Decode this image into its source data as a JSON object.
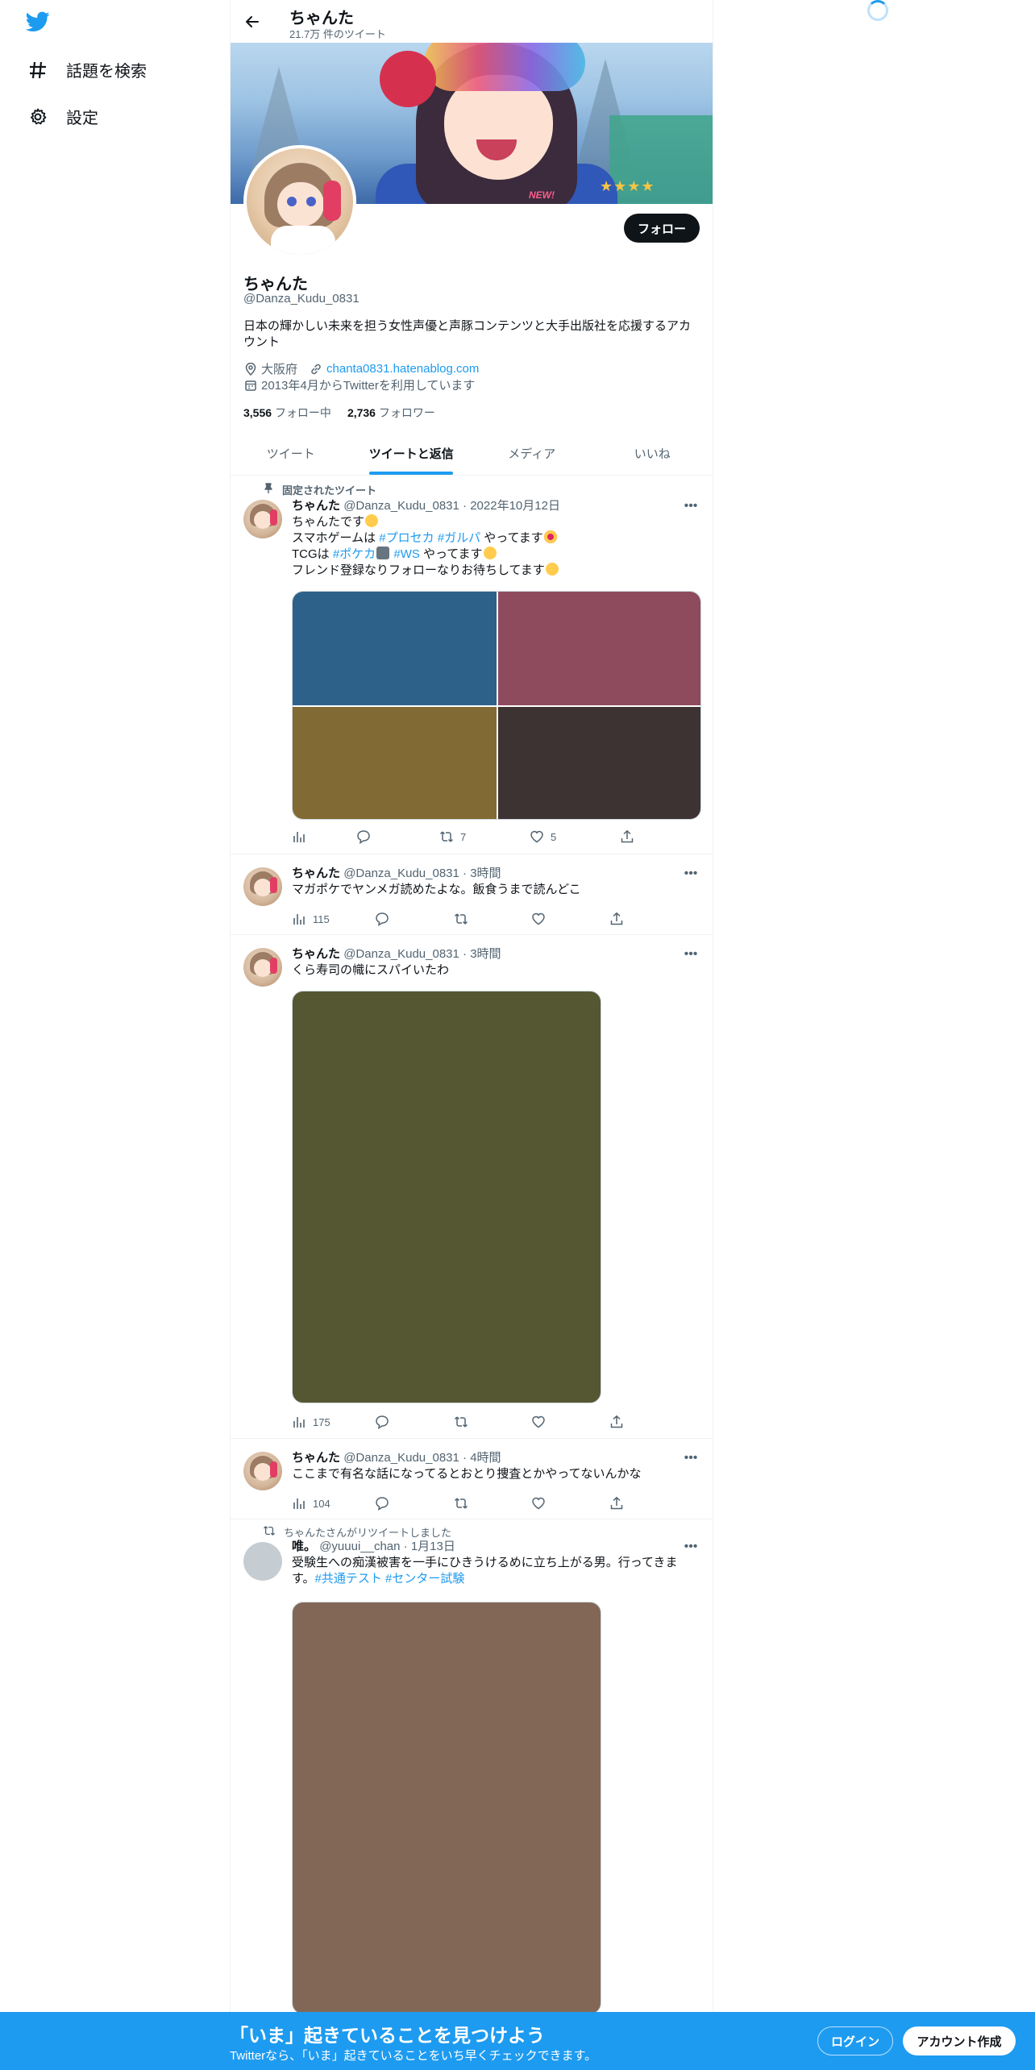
{
  "colors": {
    "accent": "#1d9bf0",
    "text": "#0f1419",
    "muted": "#536471",
    "border": "#eff3f4"
  },
  "nav": {
    "logo_icon": "twitter-bird-icon",
    "items": [
      {
        "label": "話題を検索",
        "icon": "hashtag-icon"
      },
      {
        "label": "設定",
        "icon": "gear-icon"
      }
    ]
  },
  "header": {
    "title": "ちゃんた",
    "subtitle": "21.7万 件のツイート"
  },
  "profile": {
    "name": "ちゃんた",
    "handle": "@Danza_Kudu_0831",
    "bio": "日本の輝かしい未来を担う女性声優と声豚コンテンツと大手出版社を応援するアカウント",
    "location": "大阪府",
    "url": "chanta0831.hatenablog.com",
    "joined": "2013年4月からTwitterを利用しています",
    "following_count": "3,556",
    "following_label": "フォロー中",
    "followers_count": "2,736",
    "followers_label": "フォロワー",
    "follow_button": "フォロー",
    "banner_badge": "NEW!"
  },
  "tabs": [
    {
      "label": "ツイート",
      "active": false
    },
    {
      "label": "ツイートと返信",
      "active": true
    },
    {
      "label": "メディア",
      "active": false
    },
    {
      "label": "いいね",
      "active": false
    }
  ],
  "tweets": [
    {
      "social_context": "固定されたツイート",
      "name": "ちゃんた",
      "handle": "@Danza_Kudu_0831",
      "time": "2022年10月12日",
      "lines": [
        [
          "ちゃんたです"
        ],
        [
          "スマホゲームは ",
          "#プロセカ",
          " ",
          "#ガルパ",
          " やってます"
        ],
        [
          "TCGは ",
          "#ポケカ",
          " ",
          "#WS",
          " やってます"
        ],
        [
          "フレンド登録なりフォローなりお待ちしてます"
        ]
      ],
      "images": [
        "#2e6189",
        "#8f4b5e",
        "#826a34",
        "#3d3333"
      ],
      "views": "",
      "replies": "",
      "retweets": "7",
      "likes": "5"
    },
    {
      "name": "ちゃんた",
      "handle": "@Danza_Kudu_0831",
      "time": "3時間",
      "text": "マガポケでヤンメガ読めたよな。飯食うまで読んどこ",
      "views": "115"
    },
    {
      "name": "ちゃんた",
      "handle": "@Danza_Kudu_0831",
      "time": "3時間",
      "text": "くら寿司の幟にスパイいたわ",
      "media_color": "#555733",
      "views": "175"
    },
    {
      "name": "ちゃんた",
      "handle": "@Danza_Kudu_0831",
      "time": "4時間",
      "text": "ここまで有名な話になってるとおとり捜査とかやってないんかな",
      "views": "104"
    },
    {
      "social_context": "ちゃんたさんがリツイートしました",
      "name": "唯。",
      "handle": "@yuuui__chan",
      "time": "1月13日",
      "text_parts": [
        "受験生への痴漢被害を一手にひきうけるめに立ち上がる男。行ってきます。",
        "#共通テスト",
        " ",
        "#センター試験"
      ],
      "media_color": "#836756"
    }
  ],
  "bottom_bar": {
    "title": "「いま」起きていることを見つけよう",
    "subtitle": "Twitterなら、「いま」起きていることをいち早くチェックできます。",
    "login": "ログイン",
    "signup": "アカウント作成"
  }
}
